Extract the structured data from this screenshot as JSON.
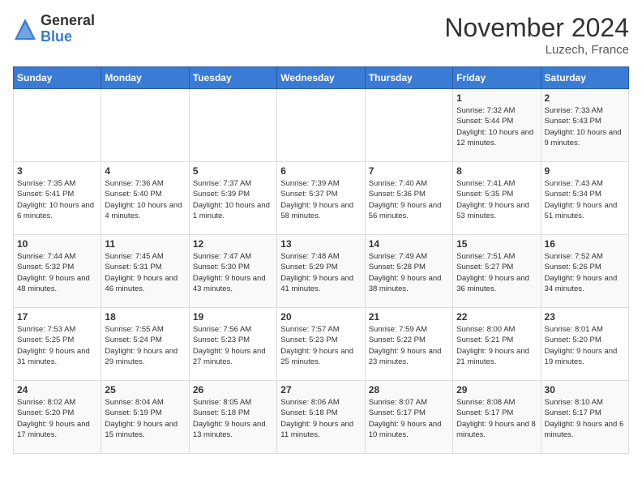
{
  "logo": {
    "general": "General",
    "blue": "Blue"
  },
  "title": "November 2024",
  "location": "Luzech, France",
  "days_of_week": [
    "Sunday",
    "Monday",
    "Tuesday",
    "Wednesday",
    "Thursday",
    "Friday",
    "Saturday"
  ],
  "weeks": [
    [
      {
        "day": "",
        "info": ""
      },
      {
        "day": "",
        "info": ""
      },
      {
        "day": "",
        "info": ""
      },
      {
        "day": "",
        "info": ""
      },
      {
        "day": "",
        "info": ""
      },
      {
        "day": "1",
        "info": "Sunrise: 7:32 AM\nSunset: 5:44 PM\nDaylight: 10 hours and 12 minutes."
      },
      {
        "day": "2",
        "info": "Sunrise: 7:33 AM\nSunset: 5:43 PM\nDaylight: 10 hours and 9 minutes."
      }
    ],
    [
      {
        "day": "3",
        "info": "Sunrise: 7:35 AM\nSunset: 5:41 PM\nDaylight: 10 hours and 6 minutes."
      },
      {
        "day": "4",
        "info": "Sunrise: 7:36 AM\nSunset: 5:40 PM\nDaylight: 10 hours and 4 minutes."
      },
      {
        "day": "5",
        "info": "Sunrise: 7:37 AM\nSunset: 5:39 PM\nDaylight: 10 hours and 1 minute."
      },
      {
        "day": "6",
        "info": "Sunrise: 7:39 AM\nSunset: 5:37 PM\nDaylight: 9 hours and 58 minutes."
      },
      {
        "day": "7",
        "info": "Sunrise: 7:40 AM\nSunset: 5:36 PM\nDaylight: 9 hours and 56 minutes."
      },
      {
        "day": "8",
        "info": "Sunrise: 7:41 AM\nSunset: 5:35 PM\nDaylight: 9 hours and 53 minutes."
      },
      {
        "day": "9",
        "info": "Sunrise: 7:43 AM\nSunset: 5:34 PM\nDaylight: 9 hours and 51 minutes."
      }
    ],
    [
      {
        "day": "10",
        "info": "Sunrise: 7:44 AM\nSunset: 5:32 PM\nDaylight: 9 hours and 48 minutes."
      },
      {
        "day": "11",
        "info": "Sunrise: 7:45 AM\nSunset: 5:31 PM\nDaylight: 9 hours and 46 minutes."
      },
      {
        "day": "12",
        "info": "Sunrise: 7:47 AM\nSunset: 5:30 PM\nDaylight: 9 hours and 43 minutes."
      },
      {
        "day": "13",
        "info": "Sunrise: 7:48 AM\nSunset: 5:29 PM\nDaylight: 9 hours and 41 minutes."
      },
      {
        "day": "14",
        "info": "Sunrise: 7:49 AM\nSunset: 5:28 PM\nDaylight: 9 hours and 38 minutes."
      },
      {
        "day": "15",
        "info": "Sunrise: 7:51 AM\nSunset: 5:27 PM\nDaylight: 9 hours and 36 minutes."
      },
      {
        "day": "16",
        "info": "Sunrise: 7:52 AM\nSunset: 5:26 PM\nDaylight: 9 hours and 34 minutes."
      }
    ],
    [
      {
        "day": "17",
        "info": "Sunrise: 7:53 AM\nSunset: 5:25 PM\nDaylight: 9 hours and 31 minutes."
      },
      {
        "day": "18",
        "info": "Sunrise: 7:55 AM\nSunset: 5:24 PM\nDaylight: 9 hours and 29 minutes."
      },
      {
        "day": "19",
        "info": "Sunrise: 7:56 AM\nSunset: 5:23 PM\nDaylight: 9 hours and 27 minutes."
      },
      {
        "day": "20",
        "info": "Sunrise: 7:57 AM\nSunset: 5:23 PM\nDaylight: 9 hours and 25 minutes."
      },
      {
        "day": "21",
        "info": "Sunrise: 7:59 AM\nSunset: 5:22 PM\nDaylight: 9 hours and 23 minutes."
      },
      {
        "day": "22",
        "info": "Sunrise: 8:00 AM\nSunset: 5:21 PM\nDaylight: 9 hours and 21 minutes."
      },
      {
        "day": "23",
        "info": "Sunrise: 8:01 AM\nSunset: 5:20 PM\nDaylight: 9 hours and 19 minutes."
      }
    ],
    [
      {
        "day": "24",
        "info": "Sunrise: 8:02 AM\nSunset: 5:20 PM\nDaylight: 9 hours and 17 minutes."
      },
      {
        "day": "25",
        "info": "Sunrise: 8:04 AM\nSunset: 5:19 PM\nDaylight: 9 hours and 15 minutes."
      },
      {
        "day": "26",
        "info": "Sunrise: 8:05 AM\nSunset: 5:18 PM\nDaylight: 9 hours and 13 minutes."
      },
      {
        "day": "27",
        "info": "Sunrise: 8:06 AM\nSunset: 5:18 PM\nDaylight: 9 hours and 11 minutes."
      },
      {
        "day": "28",
        "info": "Sunrise: 8:07 AM\nSunset: 5:17 PM\nDaylight: 9 hours and 10 minutes."
      },
      {
        "day": "29",
        "info": "Sunrise: 8:08 AM\nSunset: 5:17 PM\nDaylight: 9 hours and 8 minutes."
      },
      {
        "day": "30",
        "info": "Sunrise: 8:10 AM\nSunset: 5:17 PM\nDaylight: 9 hours and 6 minutes."
      }
    ]
  ]
}
